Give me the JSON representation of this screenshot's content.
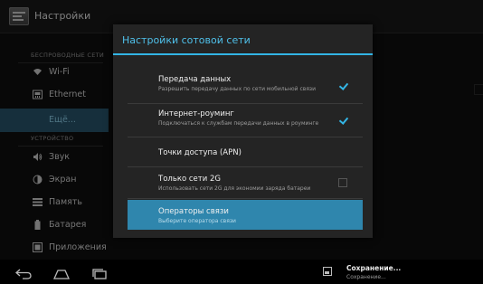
{
  "action_bar": {
    "title": "Настройки"
  },
  "sidebar": {
    "section_wireless": "БЕСПРОВОДНЫЕ СЕТИ",
    "section_device": "УСТРОЙСТВО",
    "items": [
      {
        "label": "Wi-Fi",
        "icon": "wifi-icon"
      },
      {
        "label": "Ethernet",
        "icon": "ethernet-icon"
      },
      {
        "label": "Ещё...",
        "icon": ""
      },
      {
        "label": "Звук",
        "icon": "sound-icon"
      },
      {
        "label": "Экран",
        "icon": "display-icon"
      },
      {
        "label": "Память",
        "icon": "storage-icon"
      },
      {
        "label": "Батарея",
        "icon": "battery-icon"
      },
      {
        "label": "Приложения",
        "icon": "apps-icon"
      }
    ]
  },
  "dialog": {
    "title": "Настройки сотовой сети",
    "accent": "#33b5e5",
    "rows": [
      {
        "title": "Передача данных",
        "summary": "Разрешить передачу данных по сети мобильной связи",
        "checked": true
      },
      {
        "title": "Интернет-роуминг",
        "summary": "Подключаться к службам передачи данных в роуминге",
        "checked": true
      },
      {
        "title": "Точки доступа (APN)",
        "summary": ""
      },
      {
        "title": "Только сети 2G",
        "summary": "Использовать сети 2G для экономии заряда батареи",
        "checked": false
      },
      {
        "title": "Операторы связи",
        "summary": "Выберите оператора связи"
      }
    ]
  },
  "notification": {
    "title": "Сохранение...",
    "subtitle": "Сохранение..."
  }
}
